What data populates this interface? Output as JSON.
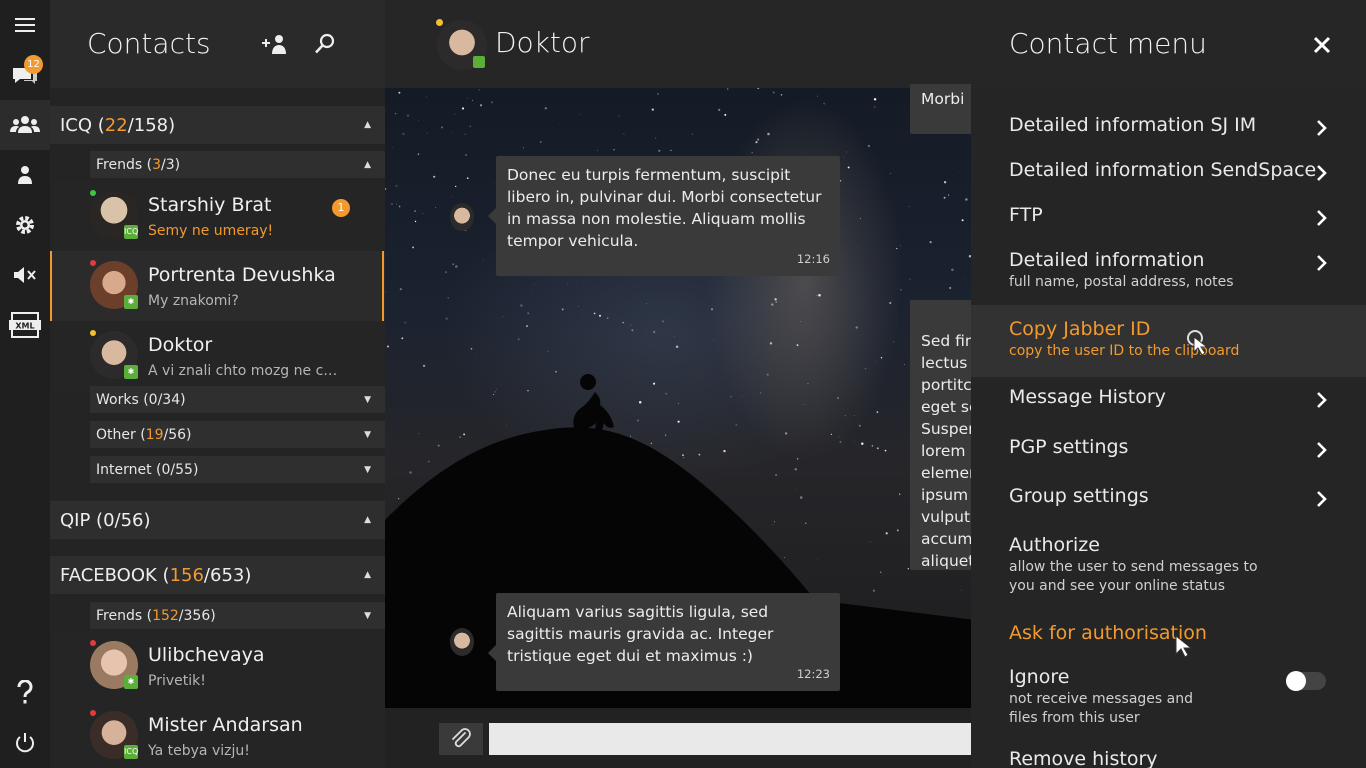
{
  "rail": {
    "chat_badge": "12",
    "icons": [
      "menu-icon",
      "chat-icon",
      "contacts-icon",
      "user-icon",
      "settings-icon",
      "mute-icon",
      "xml-icon",
      "help-icon",
      "power-icon"
    ]
  },
  "contacts": {
    "title": "Contacts",
    "groups": [
      {
        "name": "ICQ (",
        "online": "22",
        "rest": "/158)"
      },
      {
        "name": "QIP (0/56)"
      },
      {
        "name": "FACEBOOK (",
        "online": "156",
        "rest": "/653)"
      }
    ],
    "subgroups": [
      {
        "name": "Frends (",
        "online": "3",
        "rest": "/3)"
      },
      {
        "name": "Works (0/34)"
      },
      {
        "name": "Other (",
        "online": "19",
        "rest": "/56)"
      },
      {
        "name": "Internet (0/55)"
      },
      {
        "name": "Frends (",
        "online": "152",
        "rest": "/356)"
      }
    ],
    "items": [
      {
        "name": "Starshiy Brat",
        "message": "Semy ne umeray!",
        "unread": "1",
        "status_color": "#3fc43f",
        "network": "ICQ"
      },
      {
        "name": "Portrenta Devushka",
        "message": "My znakomi?",
        "status_color": "#e23b3b",
        "network": "✱"
      },
      {
        "name": "Doktor",
        "message": "A vi znali chto mozg ne ch...",
        "status_color": "#f2c12e",
        "network": "✱"
      },
      {
        "name": "Ulibchevaya",
        "message": "Privetik!",
        "status_color": "#e23b3b",
        "network": "✱"
      },
      {
        "name": "Mister Andarsan",
        "message": "Ya tebya vizju!",
        "status_color": "#e23b3b",
        "network": "ICQ"
      }
    ]
  },
  "chat": {
    "title": "Doktor",
    "messages": [
      {
        "text": "Donec eu turpis fermentum, suscipit libero in, pulvinar dui. Morbi consectetur in massa non molestie. Aliquam mollis tempor vehicula.",
        "time": "12:16"
      },
      {
        "text": "Aliquam varius sagittis ligula, sed sagittis mauris gravida ac. Integer tristique eget dui et maximus :)",
        "time": "12:23"
      }
    ],
    "partial_out_1": "Morbi",
    "partial_out_2": "Sed fin\nlectus\nportitc\neget se\nSuspen\nlorem\nelemer\nipsum\nvulputa\naccums\naliquet",
    "input_placeholder": ""
  },
  "menu": {
    "title": "Contact menu",
    "items": [
      {
        "title": "Detailed information SJ IM",
        "sub": ""
      },
      {
        "title": "Detailed information SendSpace",
        "sub": ""
      },
      {
        "title": "FTP",
        "sub": ""
      },
      {
        "title": "Detailed information",
        "sub": "full name, postal address, notes"
      },
      {
        "title": "Copy Jabber ID",
        "sub": "copy the user ID to the clipboard"
      },
      {
        "title": "Message History",
        "sub": ""
      },
      {
        "title": "PGP settings",
        "sub": ""
      },
      {
        "title": "Group settings",
        "sub": ""
      },
      {
        "title": "Authorize",
        "sub": "allow the user to send messages to you and see your online status"
      },
      {
        "title": "Ask for authorisation",
        "sub": ""
      },
      {
        "title": "Ignore",
        "sub": "not receive messages and files from this user"
      },
      {
        "title": "Remove history",
        "sub": ""
      }
    ],
    "ignore_enabled": false
  },
  "colors": {
    "accent": "#f29a2e",
    "panel": "#2a2a2a",
    "rail": "#1f1f1f"
  }
}
